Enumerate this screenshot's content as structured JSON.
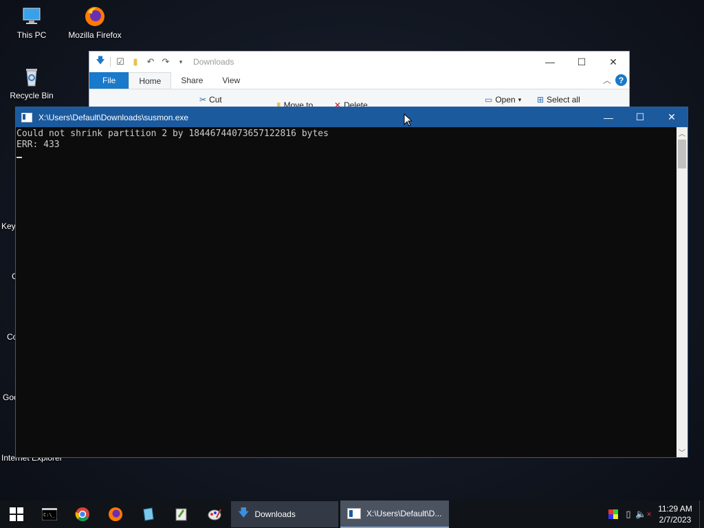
{
  "desktop": {
    "icons": [
      {
        "label": "This PC",
        "icon": "this-pc-icon"
      },
      {
        "label": "Mozilla Firefox",
        "icon": "firefox-icon"
      },
      {
        "label": "Recycle Bin",
        "icon": "recycle-bin-icon"
      }
    ],
    "partial_labels": [
      "Key",
      "C",
      "Co",
      "Goo",
      "Internet Explorer"
    ]
  },
  "explorer": {
    "title": "Downloads",
    "tabs": [
      "File",
      "Home",
      "Share",
      "View"
    ],
    "ribbon": {
      "cut": "Cut",
      "move_to": "Move to",
      "delete": "Delete",
      "open": "Open",
      "select_all": "Select all"
    }
  },
  "console": {
    "title": "X:\\Users\\Default\\Downloads\\susmon.exe",
    "lines": [
      "Could not shrink partition 2 by 18446744073657122816 bytes",
      "ERR: 433"
    ]
  },
  "taskbar": {
    "pinned": [
      "start",
      "cmd",
      "chrome",
      "firefox",
      "notepad",
      "notepad-plus",
      "paint"
    ],
    "apps": [
      {
        "label": "Downloads"
      },
      {
        "label": "X:\\Users\\Default\\D..."
      }
    ],
    "clock": {
      "time": "11:29 AM",
      "date": "2/7/2023"
    }
  },
  "colors": {
    "console_titlebar": "#1c5a9e",
    "file_tab": "#1979ca",
    "taskbar": "#101419"
  }
}
